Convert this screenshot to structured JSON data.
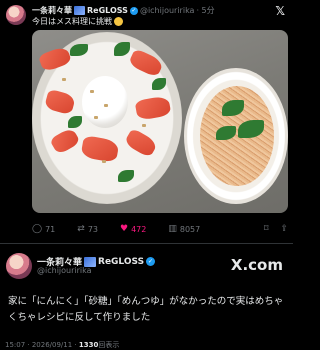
{
  "quoted": {
    "name": "一条莉々華",
    "name_suffix": "ReGLOSS",
    "handle": "@ichijouririka",
    "time": "· 5分",
    "text": "今日はメス料理に挑戦",
    "actions": {
      "replies": "71",
      "reposts": "73",
      "likes": "472",
      "views": "8057"
    }
  },
  "main": {
    "name": "一条莉々華",
    "name_suffix": "ReGLOSS",
    "handle": "@ichijouririka",
    "brand": "X.com",
    "text": "家に「にんにく」「砂糖」「めんつゆ」がなかったので実はめちゃくちゃレシピに反して作りました",
    "timestamp": "15:07 · 2026/09/11 · ",
    "views": "1330",
    "views_label": "回表示"
  },
  "colors": {
    "background": "#000000",
    "text": "#e7e9ea",
    "muted": "#71767b",
    "verified": "#1d9bf0",
    "like": "#f91880"
  }
}
